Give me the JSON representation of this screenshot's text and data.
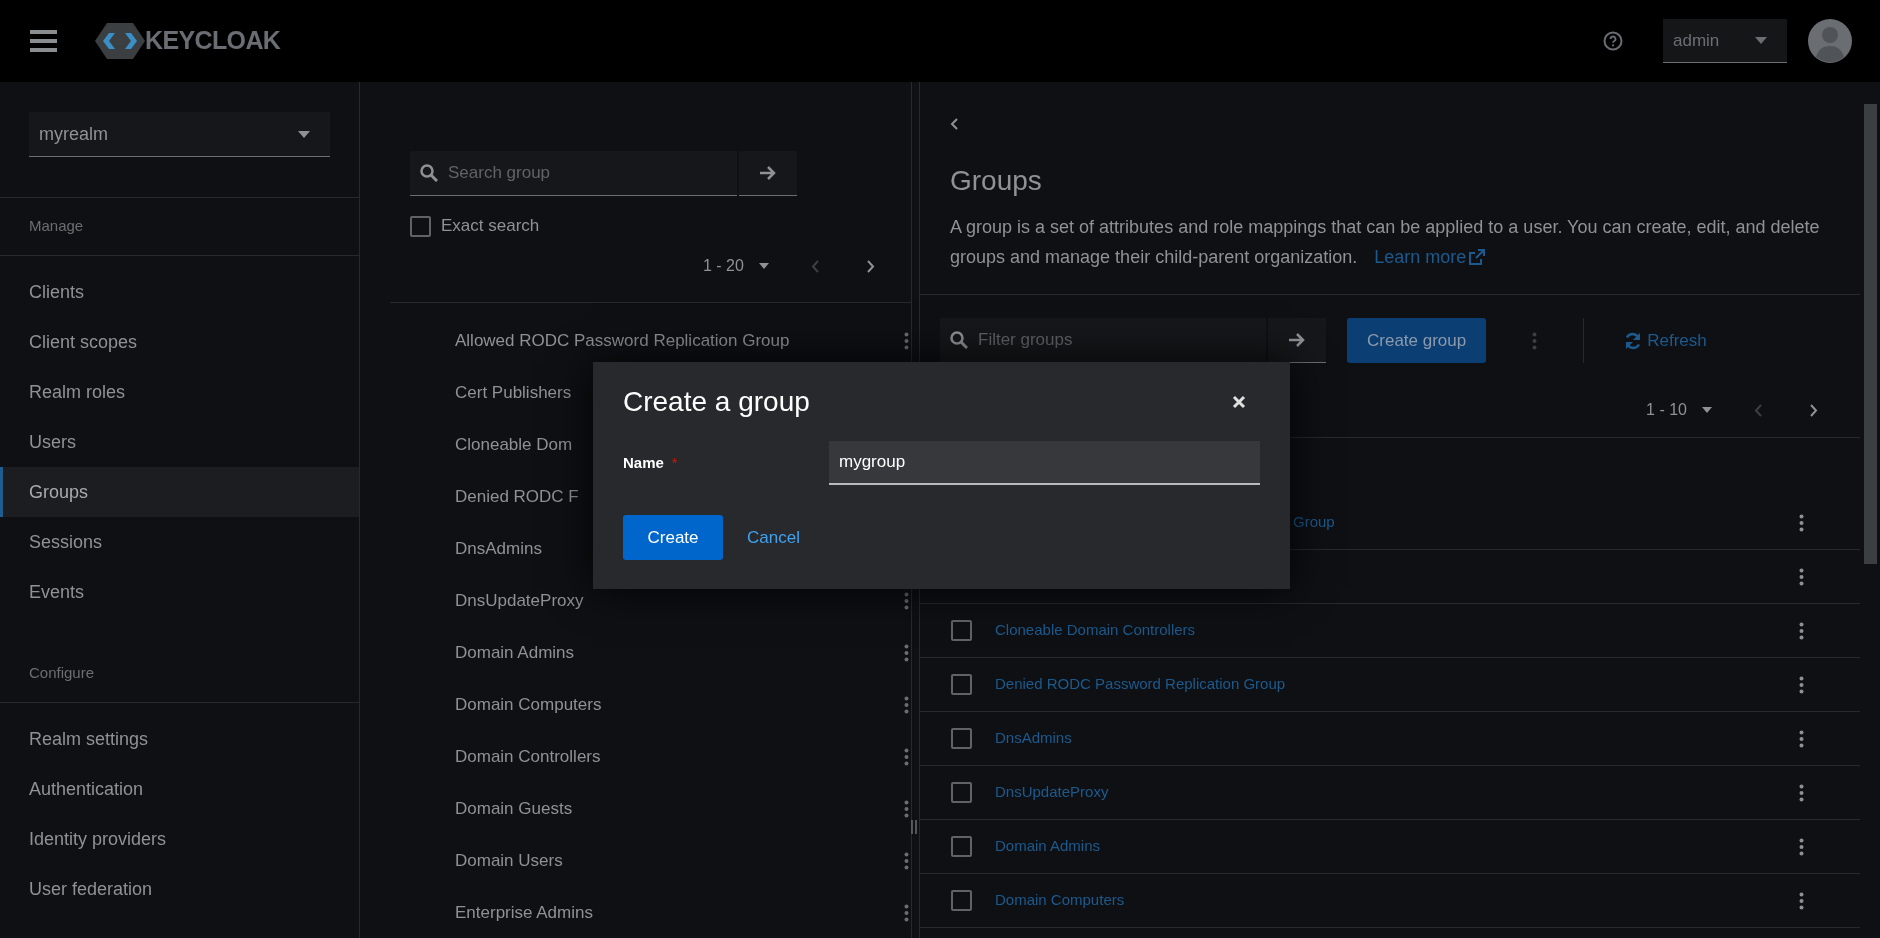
{
  "header": {
    "brand": "KEYCLOAK",
    "user_menu": "admin"
  },
  "sidebar": {
    "realm": "myrealm",
    "sections": [
      {
        "heading": "Manage",
        "items": [
          {
            "label": "Clients",
            "selected": false
          },
          {
            "label": "Client scopes",
            "selected": false
          },
          {
            "label": "Realm roles",
            "selected": false
          },
          {
            "label": "Users",
            "selected": false
          },
          {
            "label": "Groups",
            "selected": true
          },
          {
            "label": "Sessions",
            "selected": false
          },
          {
            "label": "Events",
            "selected": false
          }
        ]
      },
      {
        "heading": "Configure",
        "items": [
          {
            "label": "Realm settings",
            "selected": false
          },
          {
            "label": "Authentication",
            "selected": false
          },
          {
            "label": "Identity providers",
            "selected": false
          },
          {
            "label": "User federation",
            "selected": false
          }
        ]
      }
    ]
  },
  "tree_panel": {
    "search": {
      "placeholder": "Search group"
    },
    "exact_search": {
      "label": "Exact search",
      "checked": false
    },
    "pagination": "1 - 20",
    "items": [
      {
        "name": "Allowed RODC Password Replication Group"
      },
      {
        "name": "Cert Publishers"
      },
      {
        "name": "Cloneable Dom"
      },
      {
        "name": "Denied RODC F"
      },
      {
        "name": "DnsAdmins"
      },
      {
        "name": "DnsUpdateProxy"
      },
      {
        "name": "Domain Admins"
      },
      {
        "name": "Domain Computers"
      },
      {
        "name": "Domain Controllers"
      },
      {
        "name": "Domain Guests"
      },
      {
        "name": "Domain Users"
      },
      {
        "name": "Enterprise Admins"
      }
    ]
  },
  "groups_page": {
    "title": "Groups",
    "description": "A group is a set of attributes and role mappings that can be applied to a user. You can create, edit, and delete groups and manage their child-parent organization.",
    "learn_more": "Learn more",
    "filter": {
      "placeholder": "Filter groups"
    },
    "create_button": "Create group",
    "refresh": "Refresh",
    "pagination": "1 - 10",
    "rows": [
      {
        "name": "Group"
      },
      {},
      {
        "name": "Cloneable Domain Controllers",
        "checked": false
      },
      {
        "name": "Denied RODC Password Replication Group",
        "checked": false
      },
      {
        "name": "DnsAdmins",
        "checked": false
      },
      {
        "name": "DnsUpdateProxy",
        "checked": false
      },
      {
        "name": "Domain Admins",
        "checked": false
      },
      {
        "name": "Domain Computers",
        "checked": false
      }
    ]
  },
  "dialog": {
    "title": "Create a group",
    "field_label": "Name",
    "required_mark": "*",
    "value": "mygroup",
    "primary": "Create",
    "secondary": "Cancel"
  }
}
